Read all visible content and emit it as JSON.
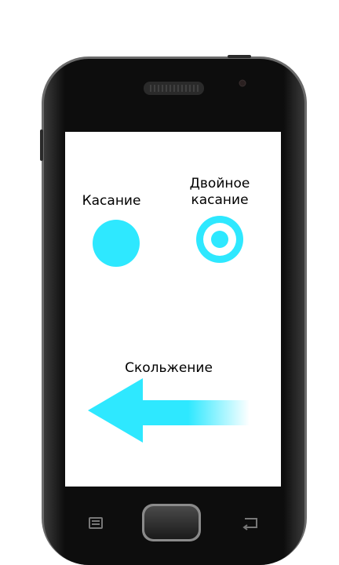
{
  "gestures": {
    "tap": {
      "label": "Касание"
    },
    "double_tap": {
      "label_line1": "Двойное",
      "label_line2": "касание"
    },
    "swipe": {
      "label": "Скольжение",
      "direction": "left"
    }
  },
  "colors": {
    "accent": "#2ee8ff",
    "phone_body": "#0c0c0c",
    "screen": "#ffffff"
  },
  "device": {
    "buttons": [
      {
        "name": "menu-icon"
      },
      {
        "name": "home-button"
      },
      {
        "name": "back-icon"
      }
    ]
  }
}
